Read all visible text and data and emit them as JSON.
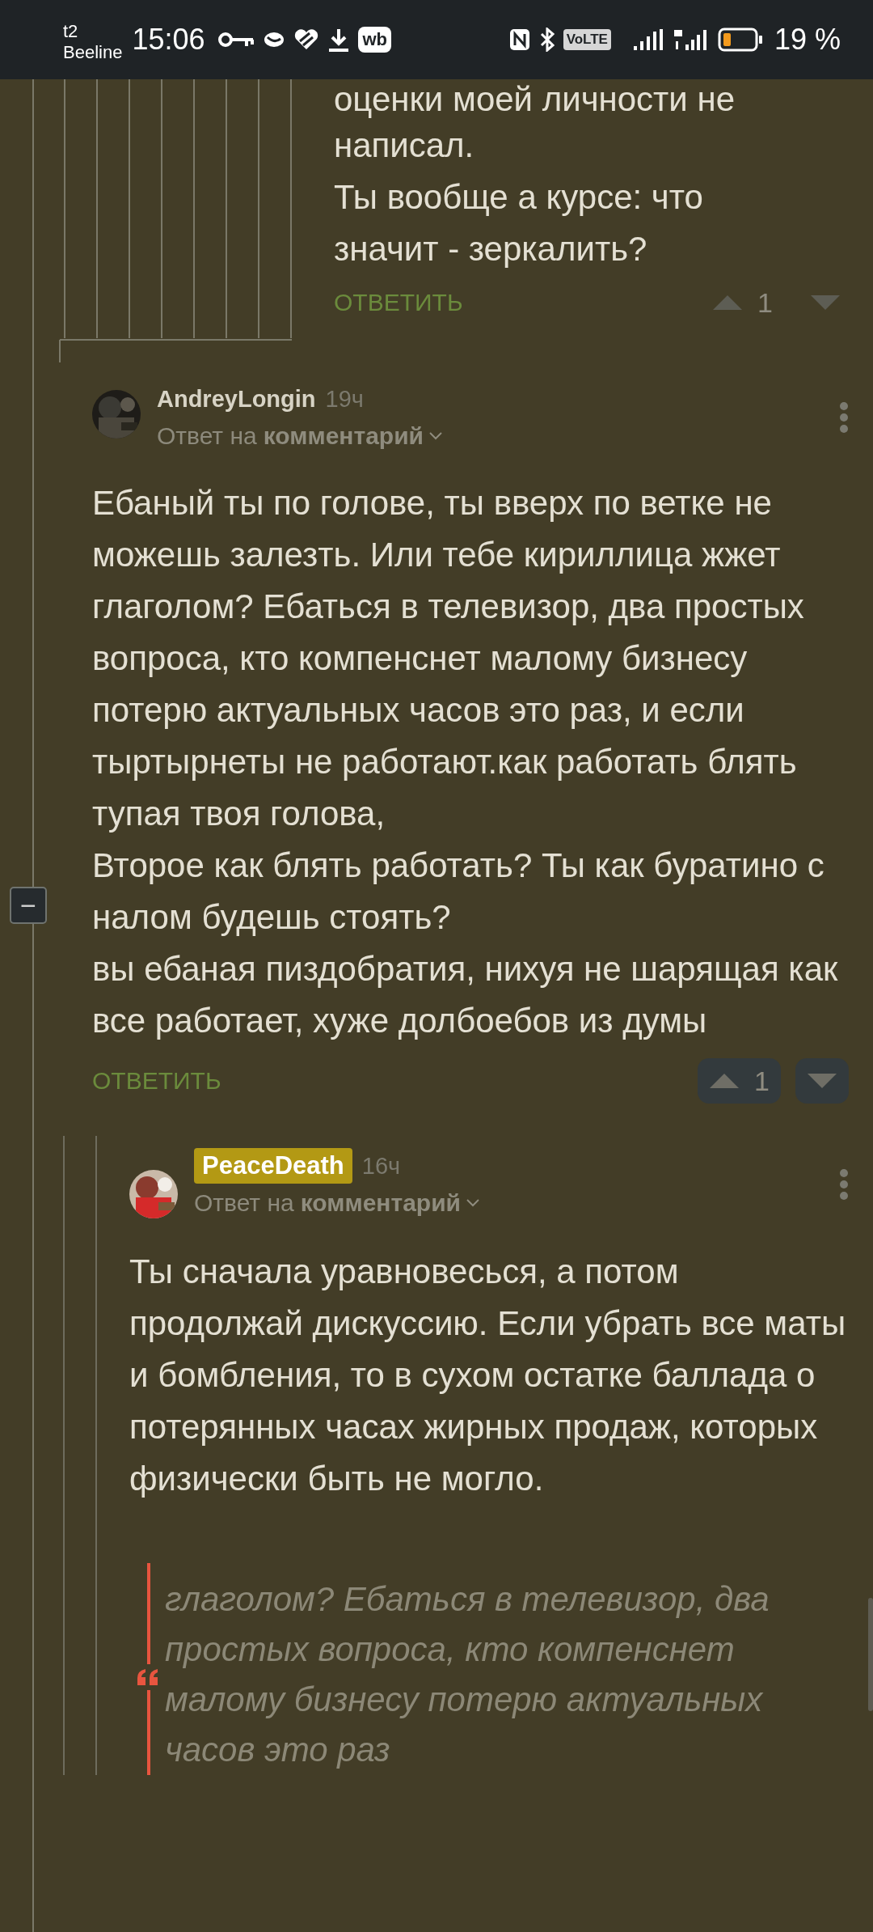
{
  "status_bar": {
    "carrier_top": "t2",
    "carrier_bottom": "Beeline",
    "time": "15:06",
    "app_badge": "wb",
    "volte_label": "VoLTE",
    "battery": "19 %"
  },
  "parent_comment": {
    "lines": [
      "оценки моей личности не",
      "написал.",
      "Ты вообще а курсе: что",
      "значит - зеркалить?"
    ],
    "reply": "ОТВЕТИТЬ",
    "votes": {
      "count": "1",
      "highlighted": false
    }
  },
  "comments": [
    {
      "author": "AndreyLongin",
      "author_badge": false,
      "time": "19ч",
      "reply_prefix": "Ответ на",
      "reply_target": "комментарий",
      "collapse": "−",
      "paragraphs": [
        "Ебаный ты по голове, ты вверх по ветке не можешь залезть. Или тебе кириллица жжет глаголом? Ебаться в телевизор, два простых вопроса, кто компенснет малому бизнесу потерю актуальных часов это раз, и если тыртырнеты не работают.как работать блять тупая твоя голова,",
        "Второе как блять работать? Ты как буратино с налом будешь стоять?",
        "вы ебаная пиздобратия, нихуя не шарящая как все работает, хуже долбоебов из думы"
      ],
      "reply": "ОТВЕТИТЬ",
      "votes": {
        "count": "1",
        "highlighted": true
      }
    },
    {
      "author": "PeaceDeath",
      "author_badge": true,
      "time": "16ч",
      "reply_prefix": "Ответ на",
      "reply_target": "комментарий",
      "paragraphs": [
        "Ты сначала уравновесься, а потом продолжай дискуссию. Если убрать все маты и бомбления, то в сухом остатке баллада о потерянных часах жирных продаж, которых физически быть не могло."
      ],
      "quote": "глаголом? Ебаться в телевизор, два простых вопроса, кто компенснет малому бизнесу потерю актуальных часов это раз"
    }
  ]
}
